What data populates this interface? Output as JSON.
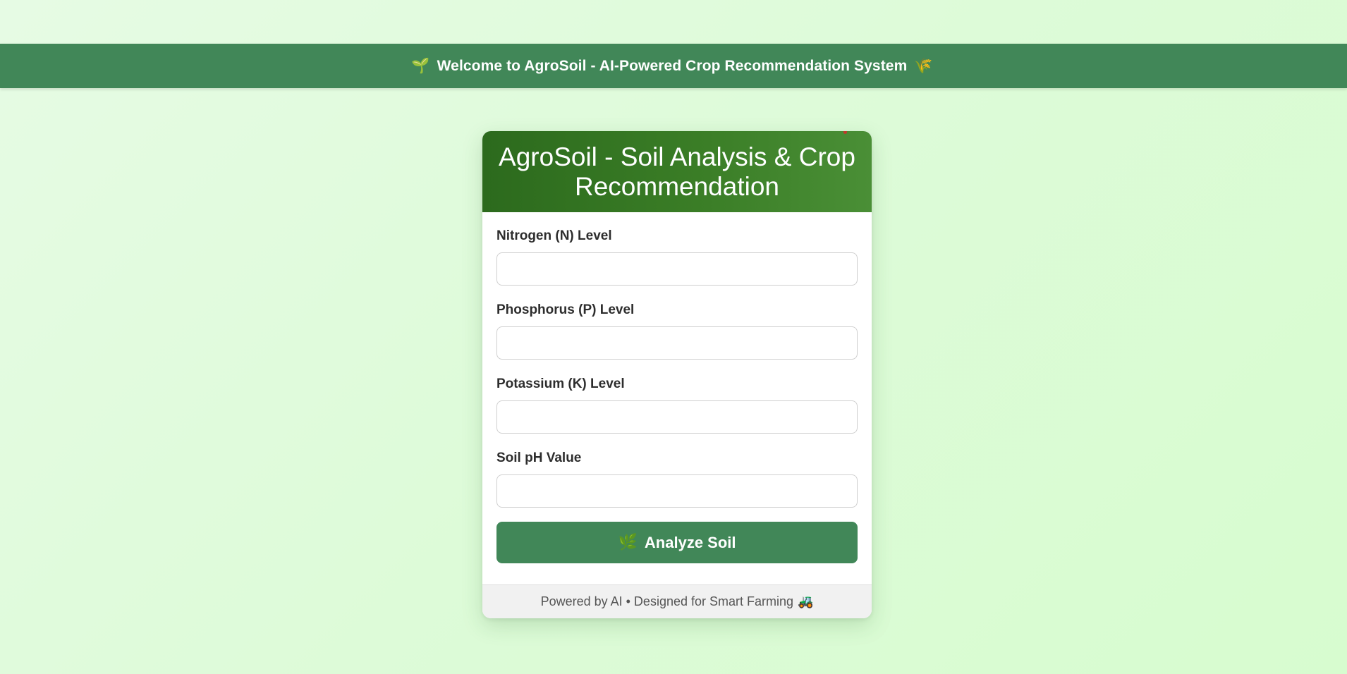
{
  "banner": {
    "left_icon": "🌱",
    "text": "Welcome to AgroSoil - AI-Powered Crop Recommendation System",
    "right_icon": "🌾"
  },
  "card": {
    "title": "AgroSoil - Soil Analysis & Crop Recommendation",
    "fields": [
      {
        "label": "Nitrogen (N) Level",
        "value": "",
        "placeholder": ""
      },
      {
        "label": "Phosphorus (P) Level",
        "value": "",
        "placeholder": ""
      },
      {
        "label": "Potassium (K) Level",
        "value": "",
        "placeholder": ""
      },
      {
        "label": "Soil pH Value",
        "value": "",
        "placeholder": ""
      }
    ],
    "submit": {
      "icon": "🌿",
      "label": "Analyze Soil"
    },
    "footer": {
      "text": "Powered by AI • Designed for Smart Farming",
      "icon": "🚜"
    }
  },
  "colors": {
    "banner_bg": "#418758",
    "header_gradient_start": "#2c6a1d",
    "header_gradient_end": "#4a8f36",
    "button_bg": "#418758",
    "page_bg": "#ddfbd8",
    "footer_bg": "#f1f1f1"
  }
}
